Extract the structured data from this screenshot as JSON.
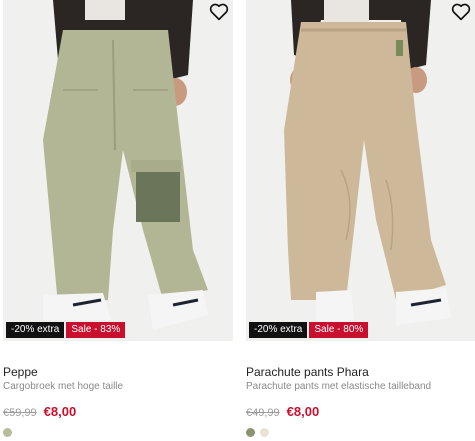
{
  "products": [
    {
      "name": "Peppe",
      "description": "Cargobroek met hoge taille",
      "price_old": "€59,99",
      "price_new": "€8,00",
      "badge_extra": "-20% extra",
      "badge_sale": "Sale - 83%",
      "swatches": [
        "#b8bc9c"
      ]
    },
    {
      "name": "Parachute pants Phara",
      "description": "Parachute pants met elastische tailleband",
      "price_old": "€49,99",
      "price_new": "€8,00",
      "badge_extra": "-20% extra",
      "badge_sale": "Sale - 80%",
      "swatches": [
        "#8a9470",
        "#e8e3d2"
      ]
    }
  ],
  "colors": {
    "sale": "#c8102e",
    "extra_badge": "#111111"
  },
  "icons": {
    "wishlist": "heart-icon"
  }
}
